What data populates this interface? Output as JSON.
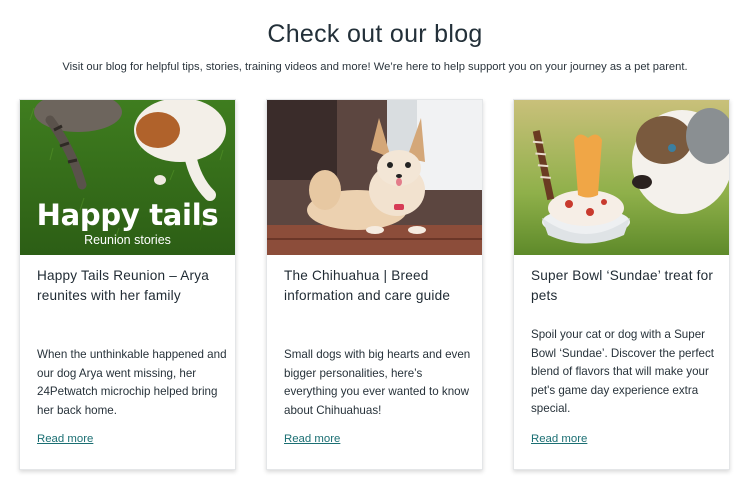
{
  "section": {
    "title": "Check out our blog",
    "subtitle": "Visit our blog for helpful tips, stories, training videos and more! We’re here to help support you on your journey as a pet parent."
  },
  "cards": [
    {
      "image_heading": "Happy tails",
      "image_subheading": "Reunion stories",
      "title": "Happy Tails Reunion – Arya reunites with her family",
      "description": "When the unthinkable happened and our dog Arya went missing, her 24Petwatch microchip helped bring her back home.",
      "link_label": "Read more"
    },
    {
      "title": "The Chihuahua | Breed information and care guide",
      "description": "Small dogs with big hearts and even bigger personalities, here’s everything you ever wanted to know about Chihuahuas!",
      "link_label": "Read more"
    },
    {
      "title": "Super Bowl ‘Sundae’ treat for pets",
      "description": "Spoil your cat or dog with a Super Bowl ‘Sundae’. Discover the perfect blend of flavors that will make your pet's game day experience extra special.",
      "link_label": "Read more"
    }
  ],
  "colors": {
    "link": "#1b6f73",
    "title": "#233039"
  }
}
